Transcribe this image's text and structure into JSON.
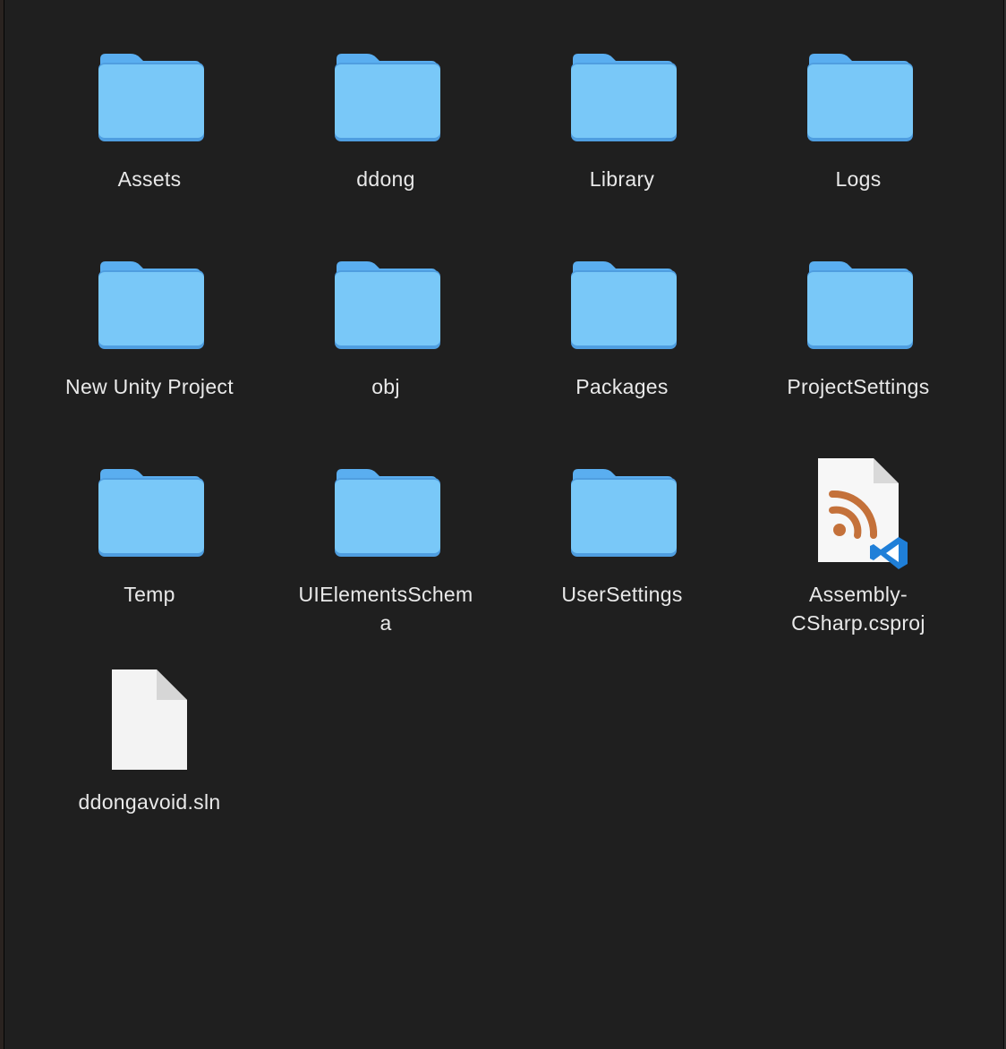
{
  "items": [
    {
      "name": "Assets",
      "kind": "folder",
      "icon": "folder-icon"
    },
    {
      "name": "ddong",
      "kind": "folder",
      "icon": "folder-icon"
    },
    {
      "name": "Library",
      "kind": "folder",
      "icon": "folder-icon"
    },
    {
      "name": "Logs",
      "kind": "folder",
      "icon": "folder-icon"
    },
    {
      "name": "New Unity Project",
      "kind": "folder",
      "icon": "folder-icon"
    },
    {
      "name": "obj",
      "kind": "folder",
      "icon": "folder-icon"
    },
    {
      "name": "Packages",
      "kind": "folder",
      "icon": "folder-icon"
    },
    {
      "name": "ProjectSettings",
      "kind": "folder",
      "icon": "folder-icon"
    },
    {
      "name": "Temp",
      "kind": "folder",
      "icon": "folder-icon"
    },
    {
      "name": "UIElementsSchem\na",
      "kind": "folder",
      "icon": "folder-icon"
    },
    {
      "name": "UserSettings",
      "kind": "folder",
      "icon": "folder-icon"
    },
    {
      "name": "Assembly-\nCSharp.csproj",
      "kind": "csproj",
      "icon": "csproj-file-icon"
    },
    {
      "name": "ddongavoid.sln",
      "kind": "file",
      "icon": "document-icon"
    }
  ],
  "colors": {
    "background": "#1f1f1f",
    "folder_front": "#79c8f8",
    "folder_back": "#5aaef0",
    "label": "#e9e9e9",
    "rss_orange": "#c4713a",
    "vscode_blue": "#1f7fd8"
  }
}
